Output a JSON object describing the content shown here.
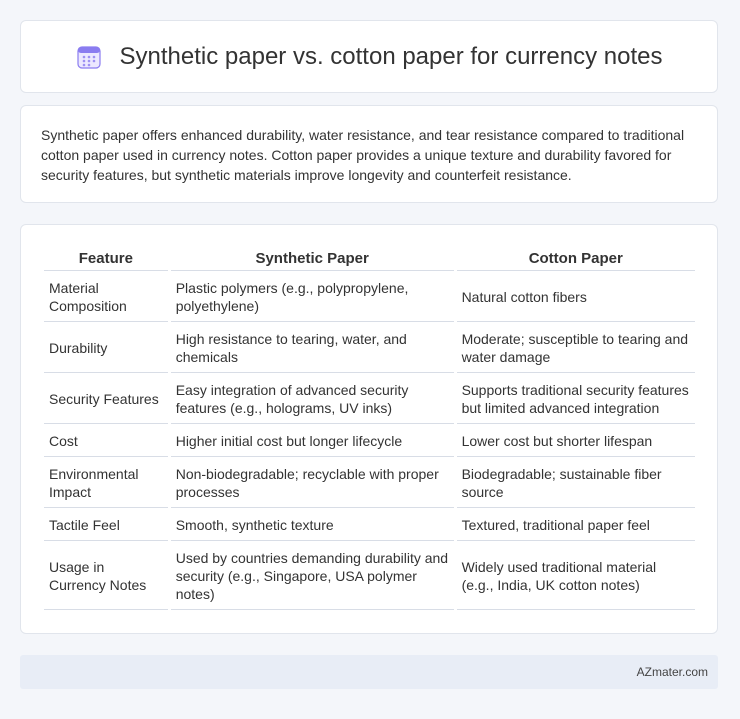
{
  "header": {
    "title": "Synthetic paper vs. cotton paper for currency notes",
    "icon": "calendar-icon",
    "icon_color": "#7b6cf6"
  },
  "summary": "Synthetic paper offers enhanced durability, water resistance, and tear resistance compared to traditional cotton paper used in currency notes. Cotton paper provides a unique texture and durability favored for security features, but synthetic materials improve longevity and counterfeit resistance.",
  "table": {
    "headers": [
      "Feature",
      "Synthetic Paper",
      "Cotton Paper"
    ],
    "rows": [
      [
        "Material Composition",
        "Plastic polymers (e.g., polypropylene, polyethylene)",
        "Natural cotton fibers"
      ],
      [
        "Durability",
        "High resistance to tearing, water, and chemicals",
        "Moderate; susceptible to tearing and water damage"
      ],
      [
        "Security Features",
        "Easy integration of advanced security features (e.g., holograms, UV inks)",
        "Supports traditional security features but limited advanced integration"
      ],
      [
        "Cost",
        "Higher initial cost but longer lifecycle",
        "Lower cost but shorter lifespan"
      ],
      [
        "Environmental Impact",
        "Non-biodegradable; recyclable with proper processes",
        "Biodegradable; sustainable fiber source"
      ],
      [
        "Tactile Feel",
        "Smooth, synthetic texture",
        "Textured, traditional paper feel"
      ],
      [
        "Usage in Currency Notes",
        "Used by countries demanding durability and security (e.g., Singapore, USA polymer notes)",
        "Widely used traditional material (e.g., India, UK cotton notes)"
      ]
    ]
  },
  "footer": {
    "brand": "AZmater.com"
  }
}
